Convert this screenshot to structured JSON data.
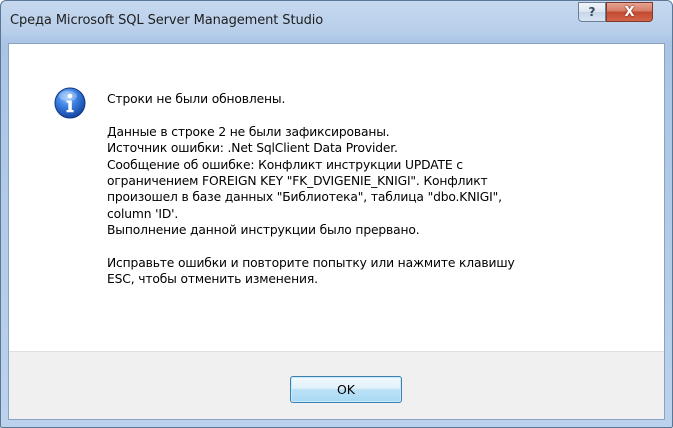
{
  "window": {
    "title": "Среда Microsoft SQL Server Management Studio",
    "help_label": "?",
    "close_label": "X"
  },
  "message": {
    "icon": "info-icon",
    "headline": "Строки не были обновлены.",
    "details": [
      "Данные в строке 2 не были зафиксированы.",
      "Источник ошибки: .Net SqlClient Data Provider.",
      "Сообщение об ошибке: Конфликт инструкции UPDATE с",
      "ограничением FOREIGN KEY \"FK_DVIGENIE_KNIGI\". Конфликт",
      "произошел в базе данных \"Библиотека\", таблица \"dbo.KNIGI\",",
      "column 'ID'.",
      "Выполнение данной инструкции было прервано."
    ],
    "hint": [
      "Исправьте ошибки и повторите попытку или нажмите клавишу",
      "ESC, чтобы отменить изменения."
    ]
  },
  "buttons": {
    "ok_label": "OK"
  },
  "colors": {
    "info_blue": "#1f5fbf",
    "close_red": "#c24a30"
  }
}
